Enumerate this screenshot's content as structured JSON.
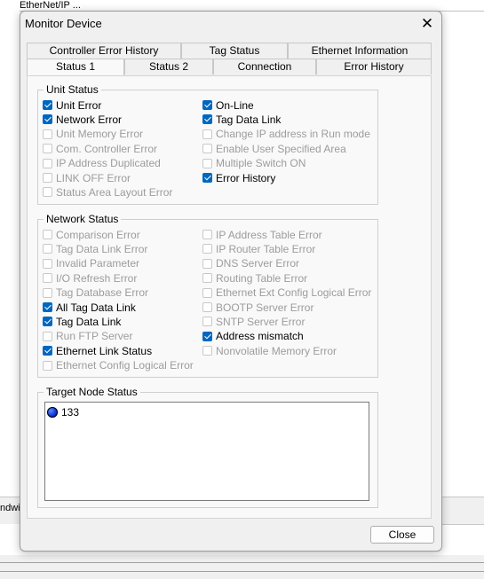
{
  "background": {
    "title": "EtherNet/IP ...",
    "left_text": "ndwid"
  },
  "dialog": {
    "title": "Monitor Device",
    "close_glyph": "✕",
    "close_button": "Close"
  },
  "tabs": {
    "row_back": [
      "Controller Error History",
      "Tag Status",
      "Ethernet Information"
    ],
    "row_front": [
      "Status 1",
      "Status 2",
      "Connection",
      "Error History"
    ],
    "selected": "Status 1"
  },
  "unit_status": {
    "legend": "Unit Status",
    "left": [
      {
        "label": "Unit Error",
        "checked": true,
        "enabled": true
      },
      {
        "label": "Network Error",
        "checked": true,
        "enabled": true
      },
      {
        "label": "Unit Memory Error",
        "checked": false,
        "enabled": false
      },
      {
        "label": "Com. Controller Error",
        "checked": false,
        "enabled": false
      },
      {
        "label": "IP Address Duplicated",
        "checked": false,
        "enabled": false
      },
      {
        "label": "LINK OFF Error",
        "checked": false,
        "enabled": false
      },
      {
        "label": "Status Area Layout Error",
        "checked": false,
        "enabled": false
      }
    ],
    "right": [
      {
        "label": "On-Line",
        "checked": true,
        "enabled": true
      },
      {
        "label": "Tag Data Link",
        "checked": true,
        "enabled": true
      },
      {
        "label": "Change IP address in Run mode",
        "checked": false,
        "enabled": false
      },
      {
        "label": "Enable User Specified Area",
        "checked": false,
        "enabled": false
      },
      {
        "label": "Multiple Switch ON",
        "checked": false,
        "enabled": false
      },
      {
        "label": "Error History",
        "checked": true,
        "enabled": true
      }
    ]
  },
  "network_status": {
    "legend": "Network Status",
    "left": [
      {
        "label": "Comparison Error",
        "checked": false,
        "enabled": false
      },
      {
        "label": "Tag Data Link Error",
        "checked": false,
        "enabled": false
      },
      {
        "label": "Invalid Parameter",
        "checked": false,
        "enabled": false
      },
      {
        "label": "I/O Refresh Error",
        "checked": false,
        "enabled": false
      },
      {
        "label": "Tag Database Error",
        "checked": false,
        "enabled": false
      },
      {
        "label": "All Tag Data Link",
        "checked": true,
        "enabled": true
      },
      {
        "label": "Tag Data Link",
        "checked": true,
        "enabled": true
      },
      {
        "label": "Run FTP Server",
        "checked": false,
        "enabled": false
      },
      {
        "label": "Ethernet Link Status",
        "checked": true,
        "enabled": true
      },
      {
        "label": "Ethernet Config Logical Error",
        "checked": false,
        "enabled": false
      }
    ],
    "right": [
      {
        "label": "IP Address Table Error",
        "checked": false,
        "enabled": false
      },
      {
        "label": "IP Router Table Error",
        "checked": false,
        "enabled": false
      },
      {
        "label": "DNS Server Error",
        "checked": false,
        "enabled": false
      },
      {
        "label": "Routing Table Error",
        "checked": false,
        "enabled": false
      },
      {
        "label": "Ethernet Ext Config Logical Error",
        "checked": false,
        "enabled": false
      },
      {
        "label": "BOOTP Server Error",
        "checked": false,
        "enabled": false
      },
      {
        "label": "SNTP Server Error",
        "checked": false,
        "enabled": false
      },
      {
        "label": "Address mismatch",
        "checked": true,
        "enabled": true
      },
      {
        "label": "Nonvolatile Memory Error",
        "checked": false,
        "enabled": false
      }
    ]
  },
  "target_node_status": {
    "legend": "Target Node Status",
    "nodes": [
      {
        "label": "133",
        "icon": "blue-node-status-icon",
        "color": "#0b2fd9"
      }
    ]
  },
  "colors": {
    "checkbox_checked": "#0067c0",
    "disabled_text": "#9c9c9c"
  }
}
